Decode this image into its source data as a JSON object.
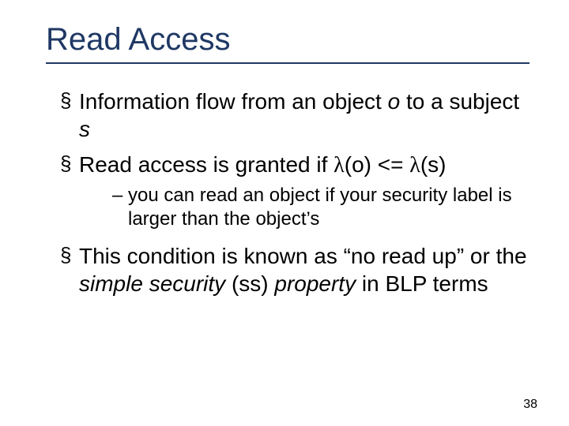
{
  "title": "Read Access",
  "bullets": {
    "b1_a": "Information flow from an object ",
    "b1_o": "o",
    "b1_b": " to a subject ",
    "b1_s": "s",
    "b2_a": "Read access is granted if ",
    "b2_lambda1": "λ",
    "b2_mid1": "(o) <= ",
    "b2_lambda2": "λ",
    "b2_mid2": "(s)",
    "sub1": "you can read an object if your security label is larger than the object’s",
    "b3_a": "This condition is known as “no read up” or the ",
    "b3_i": "simple security ",
    "b3_b": "(ss)",
    "b3_i2": " property ",
    "b3_c": "in BLP terms"
  },
  "page": "38"
}
